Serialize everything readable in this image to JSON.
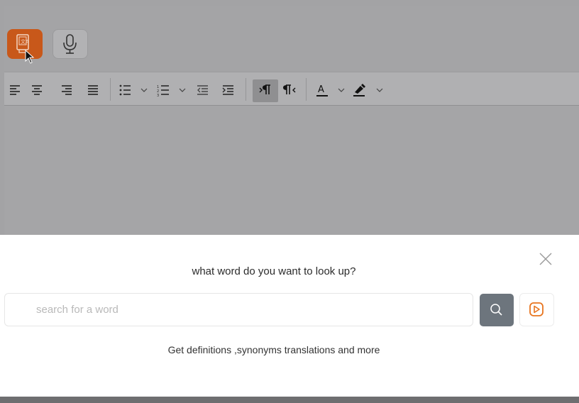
{
  "toolbar": {
    "dictionary_button": "dictionary-icon",
    "mic_button": "microphone-icon",
    "tools": [
      "align-left-icon",
      "align-center-icon",
      "align-right-icon",
      "align-justify-icon",
      "bullet-list-icon",
      "chevron-down-icon",
      "numbered-list-icon",
      "chevron-down-icon",
      "outdent-icon",
      "indent-icon",
      "ltr-paragraph-icon",
      "rtl-paragraph-icon",
      "font-color-icon",
      "chevron-down-icon",
      "highlight-color-icon",
      "chevron-down-icon"
    ]
  },
  "lookup": {
    "prompt": "what word do you want to look up?",
    "search_placeholder": "search for a word",
    "search_value": "",
    "subtitle": "Get definitions ,synonyms translations and more"
  },
  "colors": {
    "accent": "#c8581a",
    "search_button": "#6d757d",
    "play_icon": "#e8751f"
  }
}
